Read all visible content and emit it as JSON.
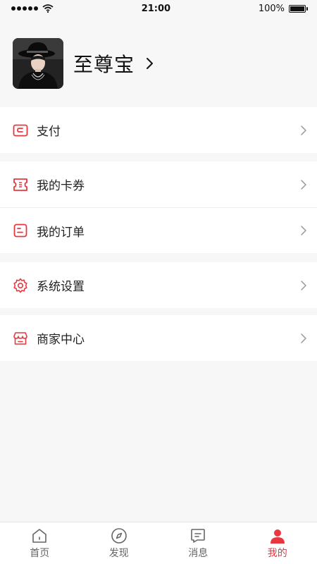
{
  "status_bar": {
    "time": "21:00",
    "battery": "100%",
    "battery_level": 1.0
  },
  "profile": {
    "name": "至尊宝"
  },
  "menu_groups": [
    {
      "items": [
        {
          "label": "支付",
          "icon": "wallet-icon"
        }
      ]
    },
    {
      "items": [
        {
          "label": "我的卡券",
          "icon": "coupon-icon"
        },
        {
          "label": "我的订单",
          "icon": "order-icon"
        }
      ]
    },
    {
      "items": [
        {
          "label": "系统设置",
          "icon": "gear-icon"
        }
      ]
    },
    {
      "items": [
        {
          "label": "商家中心",
          "icon": "store-icon"
        }
      ]
    }
  ],
  "tabs": [
    {
      "label": "首页",
      "icon": "home-icon",
      "active": false
    },
    {
      "label": "发现",
      "icon": "compass-icon",
      "active": false
    },
    {
      "label": "消息",
      "icon": "message-icon",
      "active": false
    },
    {
      "label": "我的",
      "icon": "user-icon",
      "active": true
    }
  ],
  "colors": {
    "accent": "#e8373f",
    "background": "#f7f7f7",
    "card": "#ffffff",
    "tab_inactive": "#666666"
  }
}
